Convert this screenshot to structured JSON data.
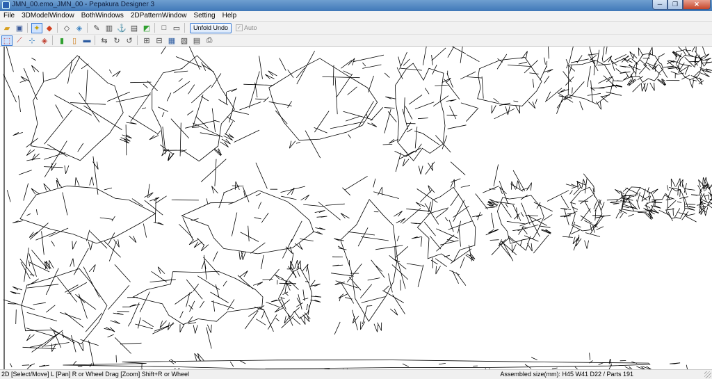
{
  "window": {
    "title": "JMN_00.emo_JMN_00 - Pepakura Designer 3",
    "controls": {
      "minimize": "─",
      "maximize": "❐",
      "close": "✕"
    }
  },
  "menu": [
    "File",
    "3DModelWindow",
    "BothWindows",
    "2DPatternWindow",
    "Setting",
    "Help"
  ],
  "toolbar1": {
    "icons": [
      "open-folder-icon",
      "save-icon",
      "light-bulb-icon",
      "cube-color-icon",
      "box-flat-icon",
      "box-shaded-icon",
      "pencil-icon",
      "cylinder-icon",
      "anchor-icon",
      "panel-icon",
      "cube-lines-icon",
      "window-single-icon",
      "window-split-icon"
    ],
    "unfold_undo_label": "Unfold Undo",
    "auto_label": "Auto",
    "auto_checked": true
  },
  "toolbar2": {
    "icons": [
      "select-tool-icon",
      "move-edge-icon",
      "snap-icon",
      "rotate-icon",
      "join-icon",
      "flap-icon",
      "panel-toggle-icon",
      "flip-icon",
      "rotate-part-icon",
      "undo-arrow-icon",
      "grid-icon",
      "align-icon",
      "part-number-icon",
      "layout-icon",
      "print-icon",
      "printer-icon"
    ]
  },
  "status": {
    "left": "2D [Select/Move] L [Pan] R or Wheel Drag [Zoom] Shift+R or Wheel",
    "right": "Assembled size(mm): H45 W41 D22 / Parts 191"
  }
}
